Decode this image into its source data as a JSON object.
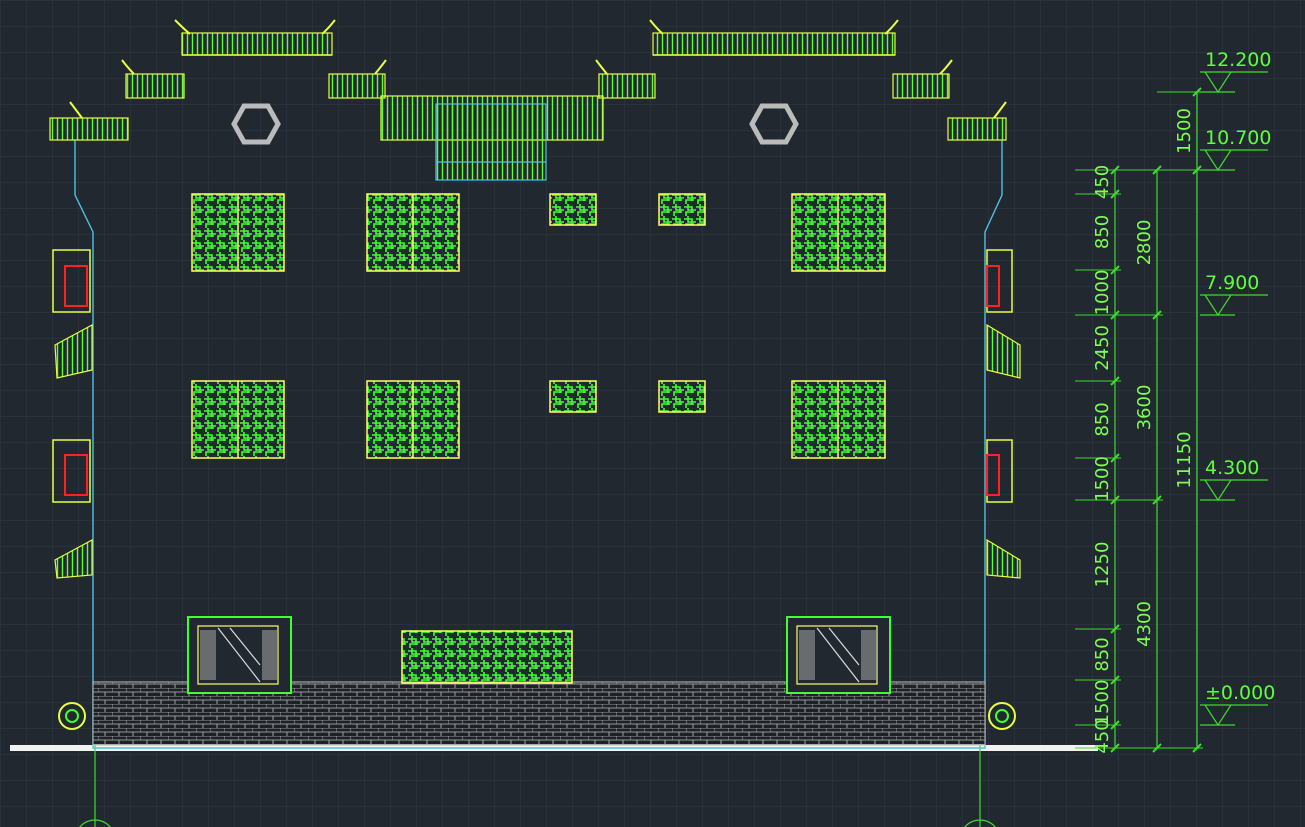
{
  "drawing": {
    "type": "building elevation",
    "colors": {
      "background": "#212830",
      "grid": "#2d3845",
      "wall_outline": "#4fc3e0",
      "window_green": "#40ff30",
      "window_frame": "#ffff66",
      "roof_yellow": "#e8ff40",
      "red_ornament": "#ff2020",
      "brick": "#bfbfbf",
      "dimension": "#3ddc2a",
      "ground": "#ffffff"
    }
  },
  "levels": [
    {
      "label": "12.200"
    },
    {
      "label": "10.700"
    },
    {
      "label": "7.900"
    },
    {
      "label": "4.300"
    },
    {
      "label": "±0.000"
    }
  ],
  "dimensions": {
    "inner_chain": [
      "450",
      "1500",
      "850",
      "1250",
      "1500",
      "850",
      "2450",
      "1000",
      "850",
      "450"
    ],
    "middle_chain": [
      "2800",
      "3600",
      "4300"
    ],
    "outer_chain": [
      "1500",
      "11150"
    ]
  }
}
